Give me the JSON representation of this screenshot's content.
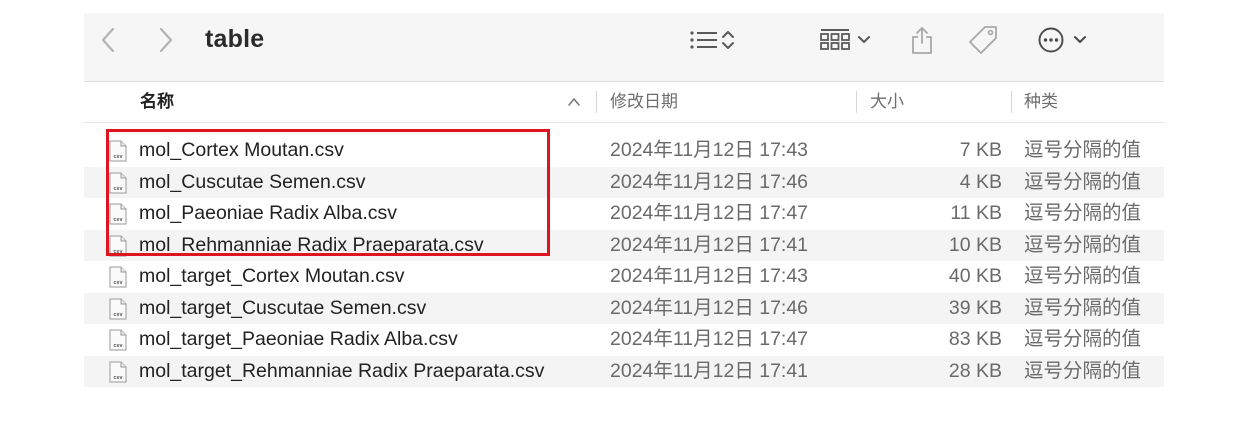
{
  "window": {
    "title": "table"
  },
  "toolbar": {
    "icons": [
      "chevron-left-icon",
      "chevron-right-icon",
      "list-view-icon",
      "group-view-icon",
      "share-icon",
      "tag-icon",
      "more-icon"
    ]
  },
  "columns": {
    "name": "名称",
    "date": "修改日期",
    "size": "大小",
    "kind": "种类"
  },
  "files": [
    {
      "name": "mol_Cortex Moutan.csv",
      "date": "2024年11月12日 17:43",
      "size": "7 KB",
      "kind": "逗号分隔的值"
    },
    {
      "name": "mol_Cuscutae Semen.csv",
      "date": "2024年11月12日 17:46",
      "size": "4 KB",
      "kind": "逗号分隔的值"
    },
    {
      "name": "mol_Paeoniae Radix Alba.csv",
      "date": "2024年11月12日 17:47",
      "size": "11 KB",
      "kind": "逗号分隔的值"
    },
    {
      "name": "mol_Rehmanniae Radix Praeparata.csv",
      "date": "2024年11月12日 17:41",
      "size": "10 KB",
      "kind": "逗号分隔的值"
    },
    {
      "name": "mol_target_Cortex Moutan.csv",
      "date": "2024年11月12日 17:43",
      "size": "40 KB",
      "kind": "逗号分隔的值"
    },
    {
      "name": "mol_target_Cuscutae Semen.csv",
      "date": "2024年11月12日 17:46",
      "size": "39 KB",
      "kind": "逗号分隔的值"
    },
    {
      "name": "mol_target_Paeoniae Radix Alba.csv",
      "date": "2024年11月12日 17:47",
      "size": "83 KB",
      "kind": "逗号分隔的值"
    },
    {
      "name": "mol_target_Rehmanniae Radix Praeparata.csv",
      "date": "2024年11月12日 17:41",
      "size": "28 KB",
      "kind": "逗号分隔的值"
    }
  ],
  "file_icon_label": "csv",
  "annotation": {
    "color": "#e0141e"
  }
}
